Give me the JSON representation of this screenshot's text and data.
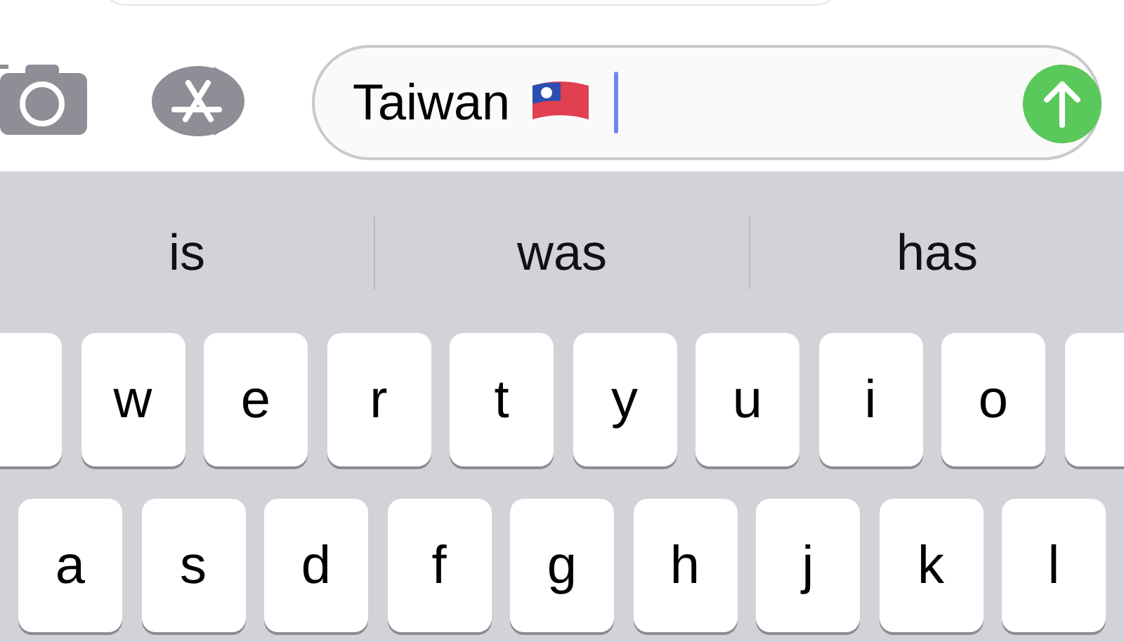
{
  "compose_bar": {
    "message_text": "Taiwan"
  },
  "suggestions": [
    "is",
    "was",
    "has"
  ],
  "key_rows": [
    [
      "w",
      "e",
      "r",
      "t",
      "y",
      "u",
      "i",
      "o"
    ],
    [
      "a",
      "s",
      "d",
      "f",
      "g",
      "h",
      "j",
      "k",
      "l"
    ]
  ]
}
